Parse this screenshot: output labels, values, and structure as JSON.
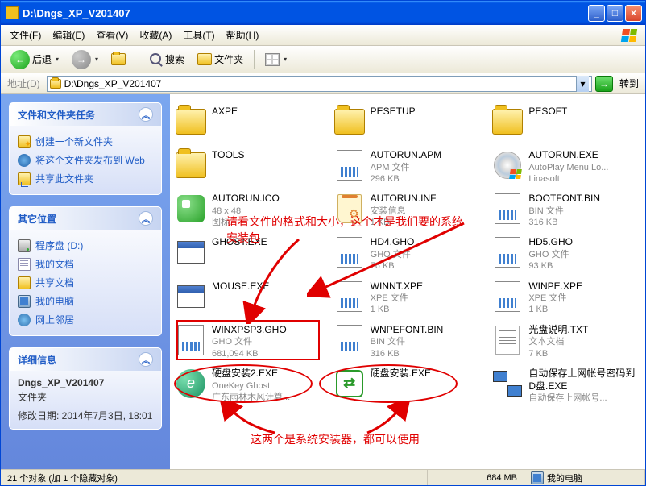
{
  "title": "D:\\Dngs_XP_V201407",
  "menu": [
    "文件(F)",
    "编辑(E)",
    "查看(V)",
    "收藏(A)",
    "工具(T)",
    "帮助(H)"
  ],
  "toolbar": {
    "back": "后退",
    "search": "搜索",
    "folders": "文件夹"
  },
  "address": {
    "label": "地址(D)",
    "path": "D:\\Dngs_XP_V201407",
    "go": "转到"
  },
  "sidebar": {
    "tasks": {
      "title": "文件和文件夹任务",
      "items": [
        "创建一个新文件夹",
        "将这个文件夹发布到 Web",
        "共享此文件夹"
      ]
    },
    "other": {
      "title": "其它位置",
      "items": [
        "程序盘 (D:)",
        "我的文档",
        "共享文档",
        "我的电脑",
        "网上邻居"
      ]
    },
    "detail": {
      "title": "详细信息",
      "name": "Dngs_XP_V201407",
      "type": "文件夹",
      "modified": "修改日期: 2014年7月3日, 18:01"
    }
  },
  "files": [
    {
      "name": "AXPE",
      "meta1": "",
      "meta2": "",
      "kind": "folder"
    },
    {
      "name": "PESETUP",
      "meta1": "",
      "meta2": "",
      "kind": "folder"
    },
    {
      "name": "PESOFT",
      "meta1": "",
      "meta2": "",
      "kind": "folder"
    },
    {
      "name": "TOOLS",
      "meta1": "",
      "meta2": "",
      "kind": "folder"
    },
    {
      "name": "AUTORUN.APM",
      "meta1": "APM 文件",
      "meta2": "296 KB",
      "kind": "apm"
    },
    {
      "name": "AUTORUN.EXE",
      "meta1": "AutoPlay Menu Lo...",
      "meta2": "Linasoft",
      "kind": "exe-cd"
    },
    {
      "name": "AUTORUN.ICO",
      "meta1": "48 x 48",
      "meta2": "图标",
      "kind": "ico"
    },
    {
      "name": "AUTORUN.INF",
      "meta1": "安装信息",
      "meta2": "1 KB",
      "kind": "inf"
    },
    {
      "name": "BOOTFONT.BIN",
      "meta1": "BIN 文件",
      "meta2": "316 KB",
      "kind": "bin"
    },
    {
      "name": "GHOST.EXE",
      "meta1": "",
      "meta2": "",
      "kind": "exe"
    },
    {
      "name": "HD4.GHO",
      "meta1": "GHO 文件",
      "meta2": "76 KB",
      "kind": "gho"
    },
    {
      "name": "HD5.GHO",
      "meta1": "GHO 文件",
      "meta2": "93 KB",
      "kind": "gho"
    },
    {
      "name": "MOUSE.EXE",
      "meta1": "",
      "meta2": "",
      "kind": "exe"
    },
    {
      "name": "WINNT.XPE",
      "meta1": "XPE 文件",
      "meta2": "1 KB",
      "kind": "bin"
    },
    {
      "name": "WINPE.XPE",
      "meta1": "XPE 文件",
      "meta2": "1 KB",
      "kind": "bin"
    },
    {
      "name": "WINXPSP3.GHO",
      "meta1": "GHO 文件",
      "meta2": "681,094 KB",
      "kind": "gho"
    },
    {
      "name": "WNPEFONT.BIN",
      "meta1": "BIN 文件",
      "meta2": "316 KB",
      "kind": "bin"
    },
    {
      "name": "光盘说明.TXT",
      "meta1": "文本文档",
      "meta2": "7 KB",
      "kind": "txt"
    },
    {
      "name": "硬盘安装2.EXE",
      "meta1": "OneKey Ghost",
      "meta2": "广东雨林木风计算...",
      "kind": "install1"
    },
    {
      "name": "硬盘安装.EXE",
      "meta1": "",
      "meta2": "",
      "kind": "install2"
    },
    {
      "name": "自动保存上网帐号密码到D盘.EXE",
      "meta1": "自动保存上网帐号...",
      "meta2": "",
      "kind": "net"
    }
  ],
  "annotation1": "请看文件的格式和大小，这个才是我们要的系统安装包",
  "annotation2": "这两个是系统安装器，都可以使用",
  "status": {
    "objects": "21 个对象 (加 1 个隐藏对象)",
    "size": "684 MB",
    "location": "我的电脑"
  }
}
